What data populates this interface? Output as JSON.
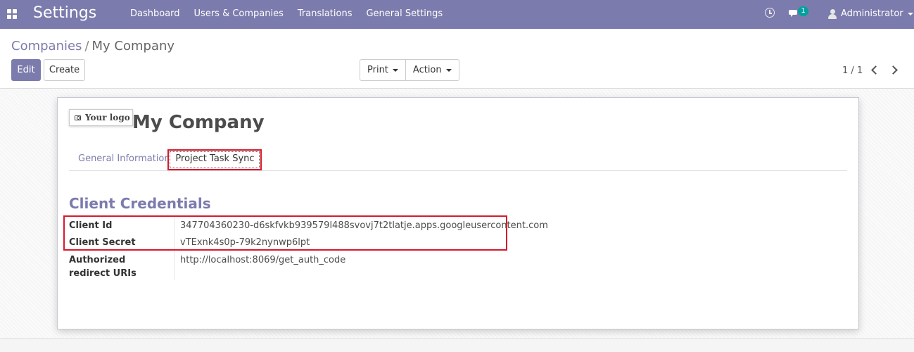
{
  "navbar": {
    "app_title": "Settings",
    "menu": [
      "Dashboard",
      "Users & Companies",
      "Translations",
      "General Settings"
    ],
    "chat_badge": "1",
    "user_name": "Administrator"
  },
  "control_panel": {
    "breadcrumb_parent": "Companies",
    "breadcrumb_separator": "/",
    "breadcrumb_current": "My Company",
    "edit_label": "Edit",
    "create_label": "Create",
    "print_label": "Print",
    "action_label": "Action",
    "pager": "1 / 1"
  },
  "form": {
    "logo_label": "Your logo",
    "company_name": "My Company",
    "tabs": [
      "General Information",
      "Project Task Sync"
    ],
    "section_title": "Client Credentials",
    "fields": [
      {
        "label": "Client Id",
        "value": "347704360230-d6skfvkb939579l488svovj7t2tlatje.apps.googleusercontent.com"
      },
      {
        "label": "Client Secret",
        "value": "vTExnk4s0p-79k2nynwp6lpt"
      },
      {
        "label": "Authorized redirect URIs",
        "value": "http://localhost:8069/get_auth_code"
      }
    ]
  },
  "colors": {
    "brand": "#7c7bad",
    "highlight": "#d9182d",
    "badge": "#00a09d"
  }
}
